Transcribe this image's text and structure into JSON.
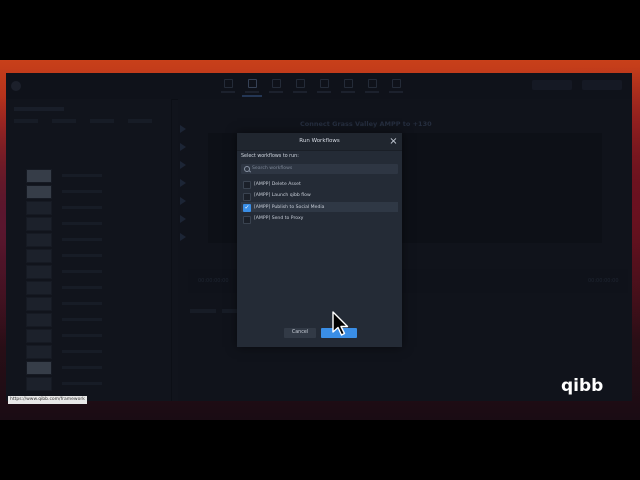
{
  "modal": {
    "title": "Run Workflows",
    "subtitle": "Select workflows to run:",
    "search_placeholder": "Search workflows",
    "workflows": [
      {
        "label": "[AMPP] Delete Asset",
        "checked": false
      },
      {
        "label": "[AMPP] Launch qibb flow",
        "checked": false
      },
      {
        "label": "[AMPP] Publish to Social Media",
        "checked": true
      },
      {
        "label": "[AMPP] Send to Proxy",
        "checked": false
      }
    ],
    "cancel_label": "Cancel",
    "checkmark": "✓",
    "close_glyph": "×"
  },
  "background": {
    "video_title": "Connect Grass Valley AMPP to +130",
    "timecode_left": "00:00:00:00",
    "timecode_right": "00:00:00:00"
  },
  "footer_url": "https://www.qibb.com/framework",
  "brand_logo": "qibb",
  "colors": {
    "accent": "#3a8ee6",
    "modal_bg": "#242b36"
  }
}
